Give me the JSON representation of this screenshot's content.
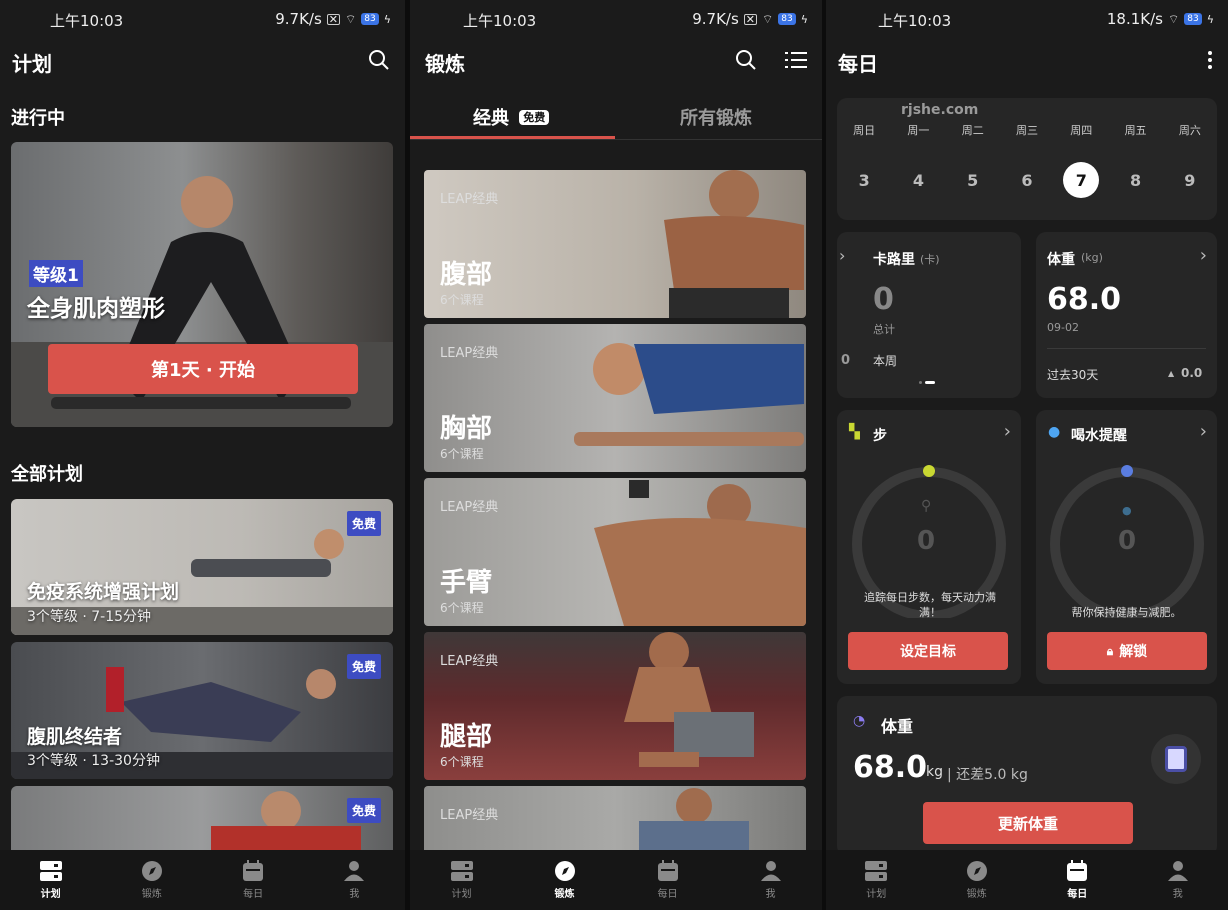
{
  "status_bars": [
    {
      "time": "上午10:03",
      "speed": "9.7K/s",
      "battery": "83"
    },
    {
      "time": "上午10:03",
      "speed": "9.7K/s",
      "battery": "83"
    },
    {
      "time": "上午10:03",
      "speed": "18.1K/s",
      "battery": "83"
    }
  ],
  "nav_items": [
    "计划",
    "锻炼",
    "每日",
    "我"
  ],
  "plans": {
    "title": "计划",
    "in_progress_heading": "进行中",
    "current": {
      "level": "等级1",
      "name": "全身肌肉塑形",
      "start_button": "第1天 · 开始"
    },
    "all_heading": "全部计划",
    "items": [
      {
        "badge": "免费",
        "name": "免疫系统增强计划",
        "meta": "3个等级 · 7-15分钟"
      },
      {
        "badge": "免费",
        "name": "腹肌终结者",
        "meta": "3个等级 · 13-30分钟"
      },
      {
        "badge": "免费",
        "name": "",
        "meta": ""
      }
    ]
  },
  "workouts": {
    "title": "锻炼",
    "tabs": [
      {
        "label": "经典",
        "badge": "免费"
      },
      {
        "label": "所有锻炼"
      }
    ],
    "items": [
      {
        "tag": "LEAP经典",
        "name": "腹部",
        "count": "6个课程"
      },
      {
        "tag": "LEAP经典",
        "name": "胸部",
        "count": "6个课程"
      },
      {
        "tag": "LEAP经典",
        "name": "手臂",
        "count": "6个课程"
      },
      {
        "tag": "LEAP经典",
        "name": "腿部",
        "count": "6个课程"
      },
      {
        "tag": "LEAP经典",
        "name": "",
        "count": ""
      }
    ]
  },
  "daily": {
    "title": "每日",
    "watermark": "rjshe.com",
    "week_labels": [
      "周日",
      "周一",
      "周二",
      "周三",
      "周四",
      "周五",
      "周六"
    ],
    "week_days": [
      "3",
      "4",
      "5",
      "6",
      "7",
      "8",
      "9"
    ],
    "calories": {
      "title": "卡路里",
      "unit": "(卡)",
      "value": "0",
      "total_label": "总计",
      "week_value": "0",
      "week_label": "本周"
    },
    "weight_card": {
      "title": "体重",
      "unit": "(kg)",
      "value": "68.0",
      "date": "09-02",
      "period": "过去30天",
      "change": "0.0"
    },
    "steps": {
      "title": "步",
      "value": "0",
      "desc": "追踪每日步数，每天动力满满！",
      "button": "设定目标"
    },
    "water": {
      "title": "喝水提醒",
      "value": "0",
      "desc": "帮你保持健康与减肥。",
      "button": "解锁"
    },
    "weight_panel": {
      "title": "体重",
      "value": "68.0",
      "unit": "kg",
      "diff": "| 还差5.0 kg",
      "button": "更新体重"
    }
  },
  "colors": {
    "accent": "#d9534b",
    "badge_blue": "#3d4cc2",
    "panel": "#262626",
    "bg": "#1b1b1b"
  }
}
